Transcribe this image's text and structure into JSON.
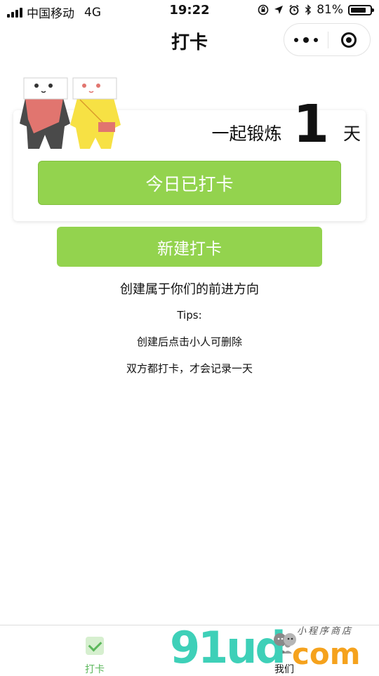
{
  "status_bar": {
    "carrier": "中国移动",
    "network": "4G",
    "time": "19:22",
    "battery_percent": "81%",
    "battery_level": 0.81,
    "icons": [
      "signal-icon",
      "orientation-lock-icon",
      "location-icon",
      "alarm-icon",
      "bluetooth-icon",
      "battery-icon"
    ]
  },
  "nav": {
    "title": "打卡",
    "icons": [
      "more-icon",
      "close-icon"
    ]
  },
  "card": {
    "days_prefix": "一起锻炼",
    "days_count": "1",
    "days_unit": "天",
    "checkin_button": "今日已打卡"
  },
  "actions": {
    "new_button": "新建打卡"
  },
  "info": {
    "slogan": "创建属于你们的前进方向",
    "tips_title": "Tips:",
    "tip_1": "创建后点击小人可删除",
    "tip_2": "双方都打卡，才会记录一天"
  },
  "tabbar": {
    "tabs": [
      {
        "label": "打卡",
        "icon": "check-icon",
        "active": true
      },
      {
        "label": "我们",
        "icon": "couple-icon",
        "active": false
      }
    ]
  },
  "watermark": {
    "brand": "91ud",
    "domain": "com",
    "tagline": "小程序商店"
  },
  "colors": {
    "accent_green": "#93d34e",
    "tab_active": "#5cb85c",
    "character_dark": "#4a4a4a",
    "character_red": "#e1756f",
    "character_yellow": "#f7e144"
  }
}
